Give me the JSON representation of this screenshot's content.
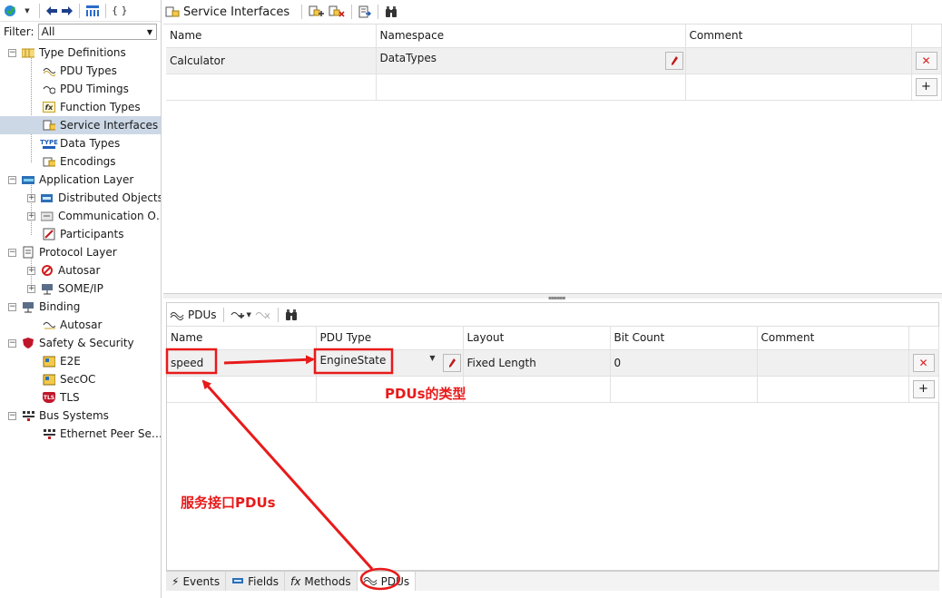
{
  "left": {
    "filter_label": "Filter:",
    "filter_value": "All",
    "tree": {
      "type_definitions": "Type Definitions",
      "pdu_types": "PDU Types",
      "pdu_timings": "PDU Timings",
      "function_types": "Function Types",
      "service_interfaces": "Service Interfaces",
      "data_types": "Data Types",
      "encodings": "Encodings",
      "application_layer": "Application Layer",
      "distributed_objects": "Distributed Objects",
      "communication_o": "Communication O…",
      "participants": "Participants",
      "protocol_layer": "Protocol Layer",
      "autosar": "Autosar",
      "someip": "SOME/IP",
      "binding": "Binding",
      "binding_autosar": "Autosar",
      "safety_security": "Safety & Security",
      "e2e": "E2E",
      "secoc": "SecOC",
      "tls": "TLS",
      "bus_systems": "Bus Systems",
      "ethernet_peer": "Ethernet Peer Se…"
    },
    "toolbar_braces": "{ }",
    "type_icon_text": "TYPE",
    "fx_icon_text": "fx",
    "tls_icon_text": "TLS"
  },
  "top": {
    "title": "Service Interfaces",
    "columns": [
      "Name",
      "Namespace",
      "Comment"
    ],
    "rows": [
      {
        "name": "Calculator",
        "namespace": "DataTypes",
        "comment": ""
      }
    ]
  },
  "bottom": {
    "title": "PDUs",
    "columns": [
      "Name",
      "PDU Type",
      "Layout",
      "Bit Count",
      "Comment"
    ],
    "rows": [
      {
        "name": "speed",
        "pdu_type": "EngineState",
        "layout": "Fixed Length",
        "bit_count": "0",
        "comment": ""
      }
    ],
    "tabs": [
      "Events",
      "Fields",
      "Methods",
      "PDUs"
    ]
  },
  "annotations": {
    "pdu_type_note": "PDUs的类型",
    "service_pdus_note": "服务接口PDUs"
  },
  "colors": {
    "annotation_red": "#e81a1a",
    "selection": "#ccd8e6",
    "delete_red": "#d22222"
  }
}
